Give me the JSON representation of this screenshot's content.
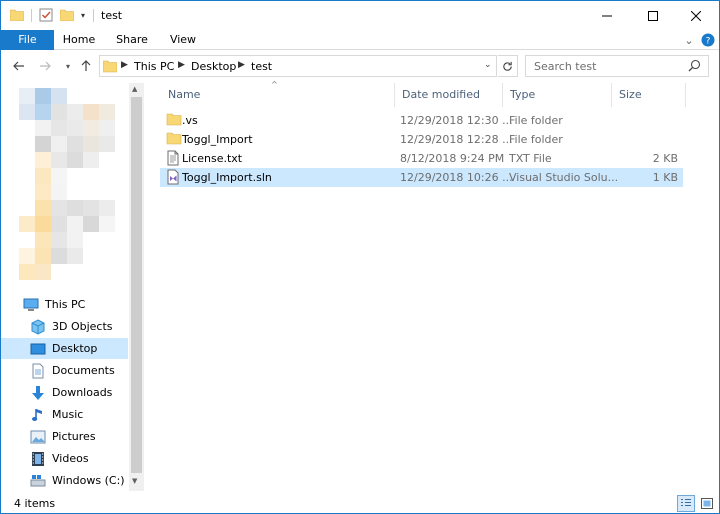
{
  "window": {
    "title": "test"
  },
  "ribbon": {
    "tabs": [
      "File",
      "Home",
      "Share",
      "View"
    ]
  },
  "address": {
    "crumbs": [
      "This PC",
      "Desktop",
      "test"
    ]
  },
  "search": {
    "placeholder": "Search test"
  },
  "sidebar": {
    "items": [
      {
        "label": "This PC",
        "icon": "computer-icon"
      },
      {
        "label": "3D Objects",
        "icon": "cube-icon"
      },
      {
        "label": "Desktop",
        "icon": "desktop-icon",
        "selected": true
      },
      {
        "label": "Documents",
        "icon": "document-icon"
      },
      {
        "label": "Downloads",
        "icon": "download-arrow-icon"
      },
      {
        "label": "Music",
        "icon": "music-note-icon"
      },
      {
        "label": "Pictures",
        "icon": "picture-icon"
      },
      {
        "label": "Videos",
        "icon": "film-icon"
      },
      {
        "label": "Windows (C:)",
        "icon": "drive-icon"
      }
    ]
  },
  "columns": [
    "Name",
    "Date modified",
    "Type",
    "Size"
  ],
  "files": [
    {
      "name": ".vs",
      "date": "12/29/2018 12:30 ...",
      "type": "File folder",
      "size": "",
      "icon": "folder-icon"
    },
    {
      "name": "Toggl_Import",
      "date": "12/29/2018 12:28 ...",
      "type": "File folder",
      "size": "",
      "icon": "folder-icon"
    },
    {
      "name": "License.txt",
      "date": "8/12/2018 9:24 PM",
      "type": "TXT File",
      "size": "2 KB",
      "icon": "text-file-icon"
    },
    {
      "name": "Toggl_Import.sln",
      "date": "12/29/2018 10:26 ...",
      "type": "Visual Studio Solu...",
      "size": "1 KB",
      "icon": "vs-solution-icon",
      "selected": true
    }
  ],
  "status": {
    "item_count": "4 items"
  },
  "colors": {
    "accent": "#1979ca",
    "selection": "#cce8ff",
    "folder": "#f8d775"
  }
}
